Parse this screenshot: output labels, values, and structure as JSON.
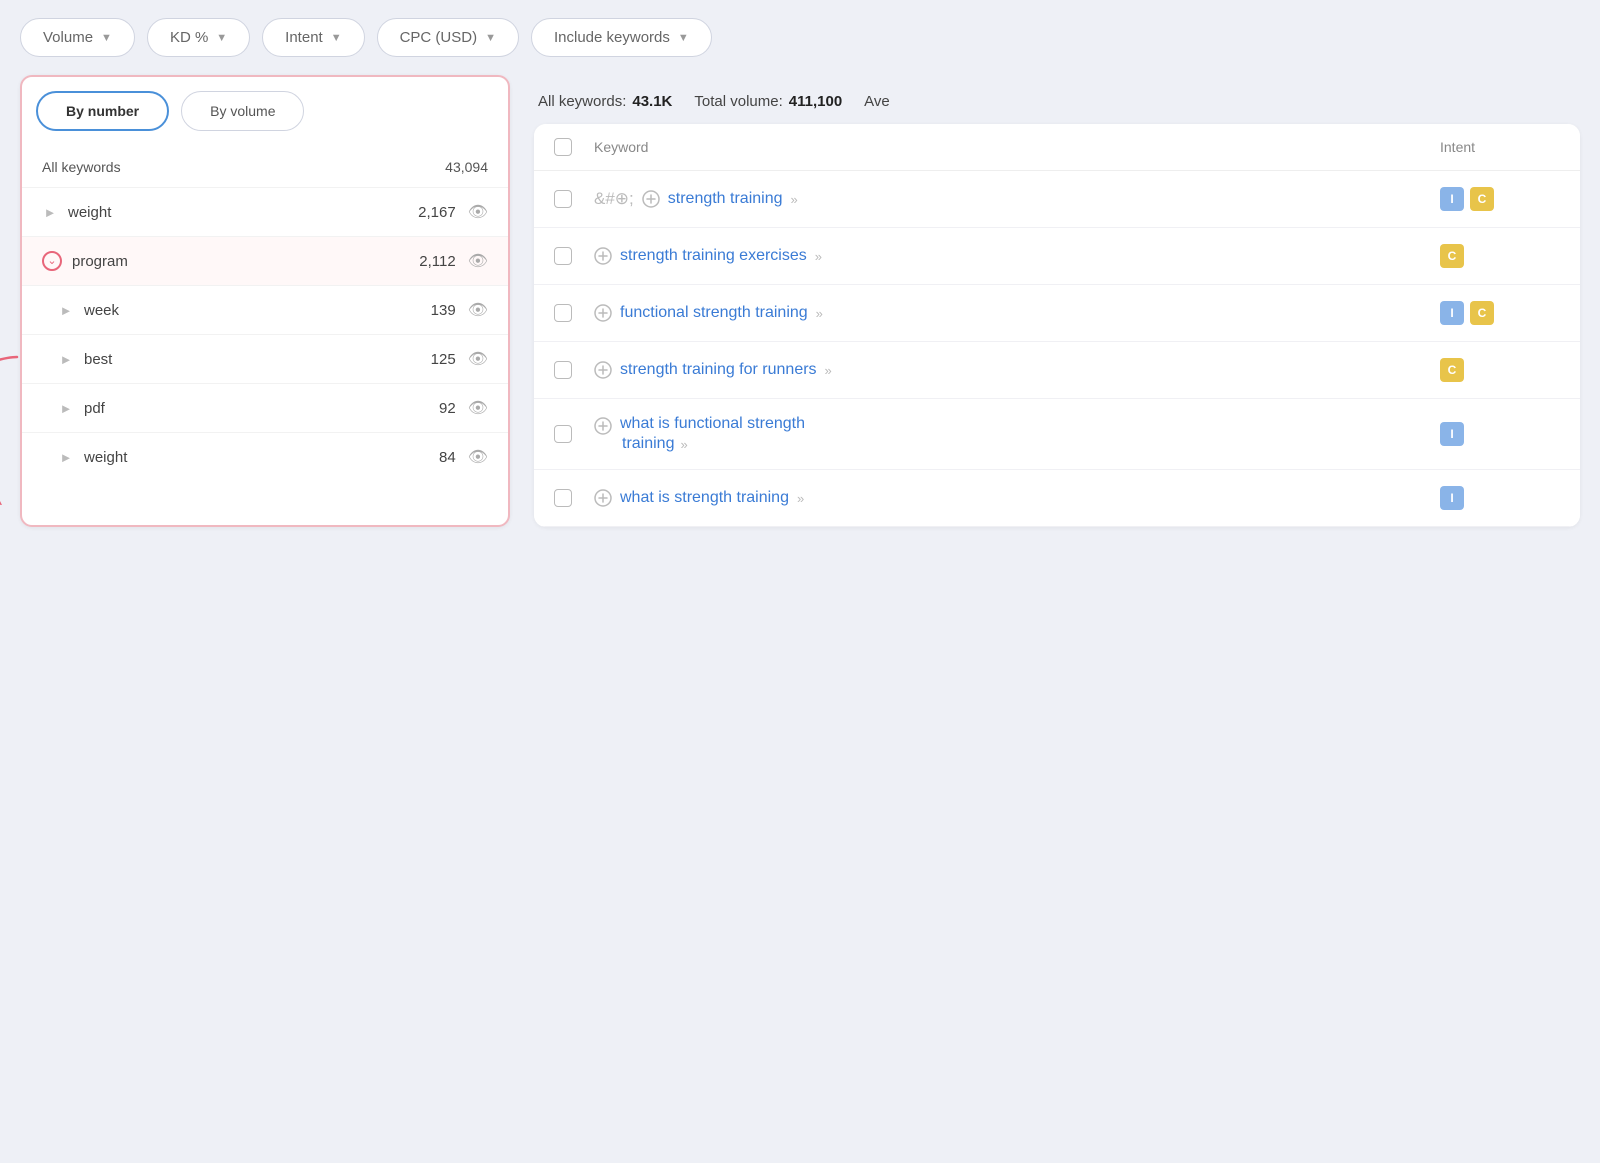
{
  "filterBar": {
    "buttons": [
      {
        "label": "Volume",
        "id": "volume-filter"
      },
      {
        "label": "KD %",
        "id": "kd-filter"
      },
      {
        "label": "Intent",
        "id": "intent-filter"
      },
      {
        "label": "CPC (USD)",
        "id": "cpc-filter"
      },
      {
        "label": "Include keywords",
        "id": "include-filter"
      }
    ]
  },
  "leftPanel": {
    "tabs": [
      {
        "label": "By number",
        "active": true
      },
      {
        "label": "By volume",
        "active": false
      }
    ],
    "allKeywords": {
      "label": "All keywords",
      "count": "43,094"
    },
    "items": [
      {
        "keyword": "weight",
        "count": "2,167",
        "expanded": false,
        "indent": false
      },
      {
        "keyword": "program",
        "count": "2,112",
        "expanded": true,
        "indent": false,
        "highlighted": true
      },
      {
        "keyword": "week",
        "count": "139",
        "expanded": false,
        "indent": true
      },
      {
        "keyword": "best",
        "count": "125",
        "expanded": false,
        "indent": true
      },
      {
        "keyword": "pdf",
        "count": "92",
        "expanded": false,
        "indent": true
      },
      {
        "keyword": "weight",
        "count": "84",
        "expanded": false,
        "indent": true
      }
    ]
  },
  "rightPanel": {
    "summary": {
      "allKeywordsLabel": "All keywords:",
      "allKeywordsValue": "43.1K",
      "totalVolumeLabel": "Total volume:",
      "totalVolumeValue": "411,100",
      "aveLabel": "Ave"
    },
    "tableHeader": {
      "keywordCol": "Keyword",
      "intentCol": "Intent"
    },
    "rows": [
      {
        "keyword": "strength training",
        "intent": [
          "I",
          "C"
        ]
      },
      {
        "keyword": "strength training exercises",
        "intent": [
          "C"
        ]
      },
      {
        "keyword": "functional strength training",
        "intent": [
          "I",
          "C"
        ]
      },
      {
        "keyword": "strength training for runners",
        "intent": [
          "C"
        ]
      },
      {
        "keyword": "what is functional strength training",
        "intent": [
          "I"
        ],
        "multiline": true
      },
      {
        "keyword": "what is strength training",
        "intent": [
          "I"
        ]
      }
    ]
  }
}
